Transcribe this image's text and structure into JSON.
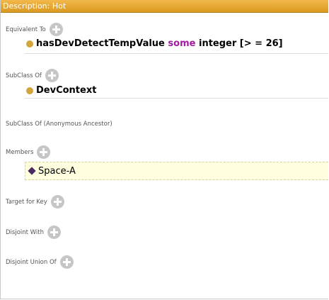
{
  "title": "Description: Hot",
  "sections": {
    "equivalent_to": {
      "label": "Equivalent To",
      "expression": {
        "property": "hasDevDetectTempValue",
        "quantifier": "some",
        "datatype": "integer",
        "facet": "[> = 26]"
      }
    },
    "subclass_of": {
      "label": "SubClass Of",
      "item": "DevContext"
    },
    "subclass_anon": {
      "label": "SubClass Of (Anonymous Ancestor)"
    },
    "members": {
      "label": "Members",
      "item": "Space-A"
    },
    "target_for_key": {
      "label": "Target for Key"
    },
    "disjoint_with": {
      "label": "Disjoint With"
    },
    "disjoint_union_of": {
      "label": "Disjoint Union Of"
    }
  },
  "icons": {
    "class": "class-circle-icon",
    "individual": "individual-diamond-icon",
    "add": "add-circle-icon"
  },
  "colors": {
    "title_bar": "#dc9a1f",
    "class_dot": "#d1a53a",
    "keyword": "#a319a3",
    "member_bg": "#ffffe0"
  }
}
